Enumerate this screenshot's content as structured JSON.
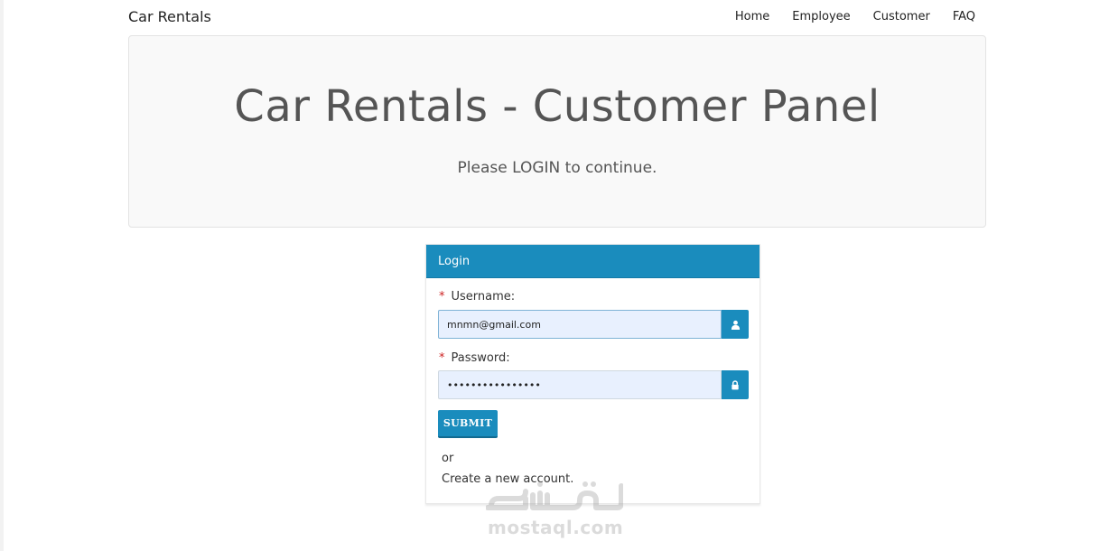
{
  "navbar": {
    "brand": "Car Rentals",
    "links": [
      "Home",
      "Employee",
      "Customer",
      "FAQ"
    ]
  },
  "jumbotron": {
    "title": "Car Rentals - Customer Panel",
    "subtitle": "Please LOGIN to continue."
  },
  "login_panel": {
    "heading": "Login",
    "username": {
      "required_mark": "*",
      "label": "Username:",
      "value": "mnmn@gmail.com",
      "icon": "user-icon"
    },
    "password": {
      "required_mark": "*",
      "label": "Password:",
      "value": "••••••••••••••••",
      "icon": "lock-icon"
    },
    "submit_label": "SUBMIT",
    "or_text": "or",
    "create_account_text": "Create a new account."
  },
  "watermark": {
    "latin": "mostaql.com",
    "arabic": "مستقل"
  },
  "colors": {
    "primary": "#1a8cbd",
    "jumbotron_bg": "#f9f9f9",
    "required": "#cc2222",
    "input_bg": "#e8f0fe"
  }
}
